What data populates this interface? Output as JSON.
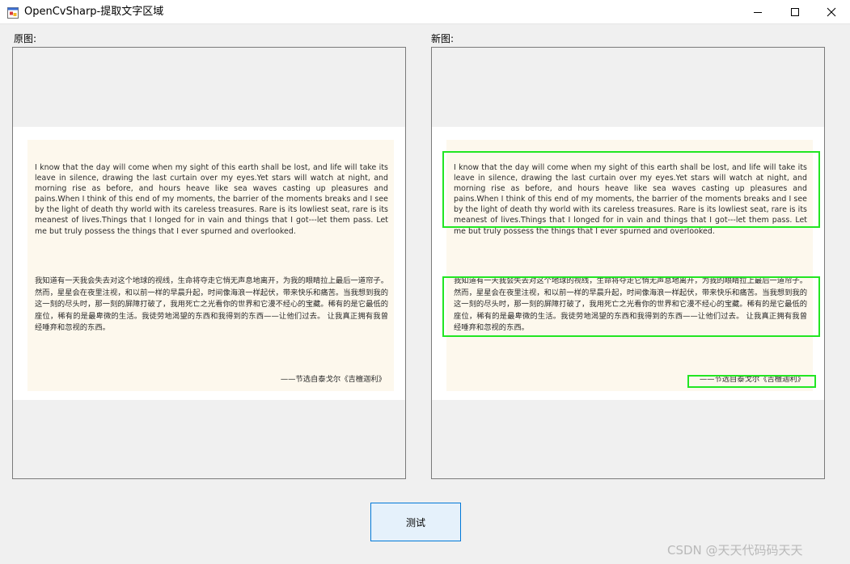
{
  "window": {
    "title": "OpenCvSharp-提取文字区域",
    "icon": "winforms-app-icon",
    "controls": [
      "minimize-icon",
      "maximize-icon",
      "close-icon"
    ]
  },
  "labels": {
    "original": "原图:",
    "new": "新图:"
  },
  "document": {
    "english": "I know that the day will come when my sight of this earth shall be lost, and life will take its leave in silence, drawing the last curtain over my eyes.Yet stars will watch at night, and morning rise as before, and hours heave like sea waves casting up pleasures and pains.When I think of this end of my moments, the barrier of the moments breaks and I see by the light of death thy world with its careless treasures. Rare is its lowliest seat, rare is its meanest of lives.Things that I longed for in vain and things that I got---let them pass. Let me but truly possess the things that I ever spurned and overlooked.",
    "chinese": "我知道有一天我会失去对这个地球的视线，生命将夺走它悄无声息地离开，为我的眼睛拉上最后一道帘子。然而，星星会在夜里注视，和以前一样的早晨升起，时间像海浪一样起伏，带来快乐和痛苦。当我想到我的这一刻的尽头时，那一刻的屏障打破了，我用死亡之光看你的世界和它漫不经心的宝藏。稀有的是它最低的座位，稀有的是最卑微的生活。我徒劳地渴望的东西和我得到的东西——让他们过去。 让我真正拥有我曾经唾弃和忽视的东西。",
    "signature": "——节选自泰戈尔《吉檀迦利》"
  },
  "detection": {
    "box_color": "#22e622",
    "regions": [
      "english-paragraph",
      "chinese-paragraph",
      "signature"
    ]
  },
  "buttons": {
    "test": "测试"
  },
  "watermark": "CSDN @天天代码码天天"
}
